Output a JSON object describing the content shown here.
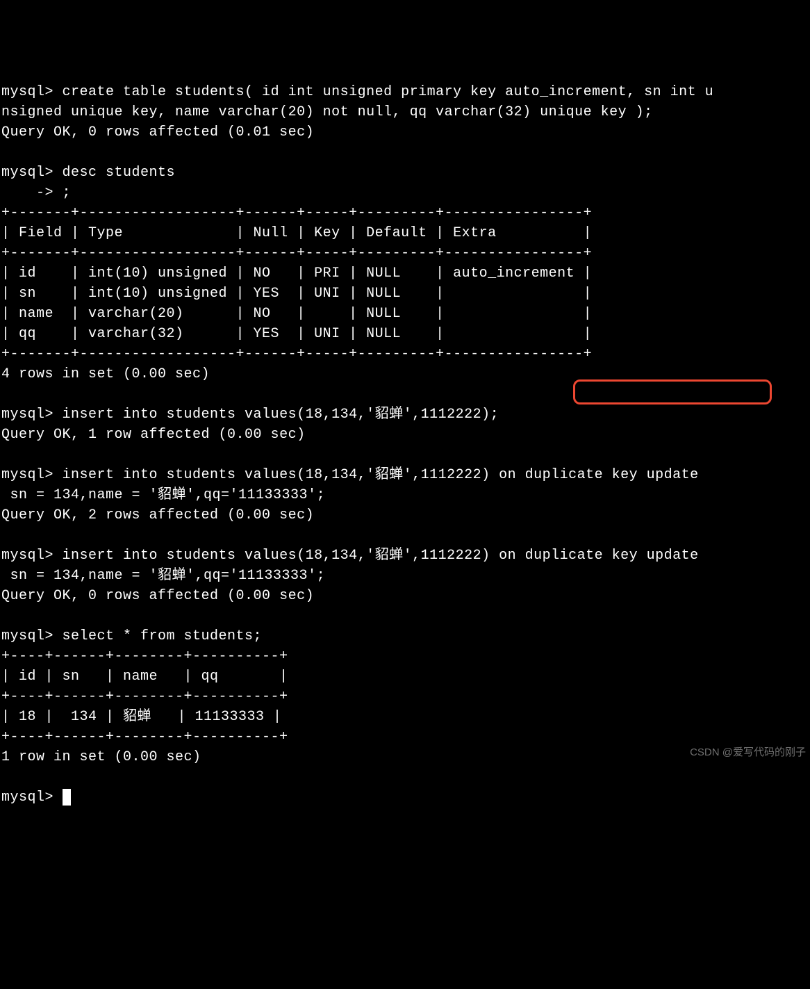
{
  "prompt": "mysql> ",
  "continuation_prompt": "    -> ",
  "commands": {
    "create_table": "create table students( id int unsigned primary key auto_increment, sn int unsigned unique key, name varchar(20) not null, qq varchar(32) unique key );",
    "create_result": "Query OK, 0 rows affected (0.01 sec)",
    "desc_cmd": "desc students",
    "desc_continuation": ";",
    "insert1": "insert into students values(18,134,'貂蝉',1112222);",
    "insert1_result": "Query OK, 1 row affected (0.00 sec)",
    "insert2_line1": "insert into students values(18,134,'貂蝉',1112222) on duplicate key update",
    "insert2_line2": " sn = 134,name = '貂蝉',qq='11133333';",
    "insert2_result": "Query OK, 2 rows affected (0.00 sec)",
    "insert3_line1": "insert into students values(18,134,'貂蝉',1112222) on duplicate key update",
    "insert3_line2": " sn = 134,name = '貂蝉',qq='11133333';",
    "insert3_result": "Query OK, 0 rows affected (0.00 sec)",
    "select_cmd": "select * from students;"
  },
  "desc_table": {
    "border": "+-------+------------------+------+-----+---------+----------------+",
    "header": "| Field | Type             | Null | Key | Default | Extra          |",
    "rows": [
      "| id    | int(10) unsigned | NO   | PRI | NULL    | auto_increment |",
      "| sn    | int(10) unsigned | YES  | UNI | NULL    |                |",
      "| name  | varchar(20)      | NO   |     | NULL    |                |",
      "| qq    | varchar(32)      | YES  | UNI | NULL    |                |"
    ],
    "footer": "4 rows in set (0.00 sec)"
  },
  "select_table": {
    "border": "+----+------+--------+----------+",
    "header": "| id | sn   | name   | qq       |",
    "rows": [
      "| 18 |  134 | 貂蝉   | 11133333 |"
    ],
    "footer": "1 row in set (0.00 sec)"
  },
  "watermark": "CSDN @爱写代码的刚子"
}
